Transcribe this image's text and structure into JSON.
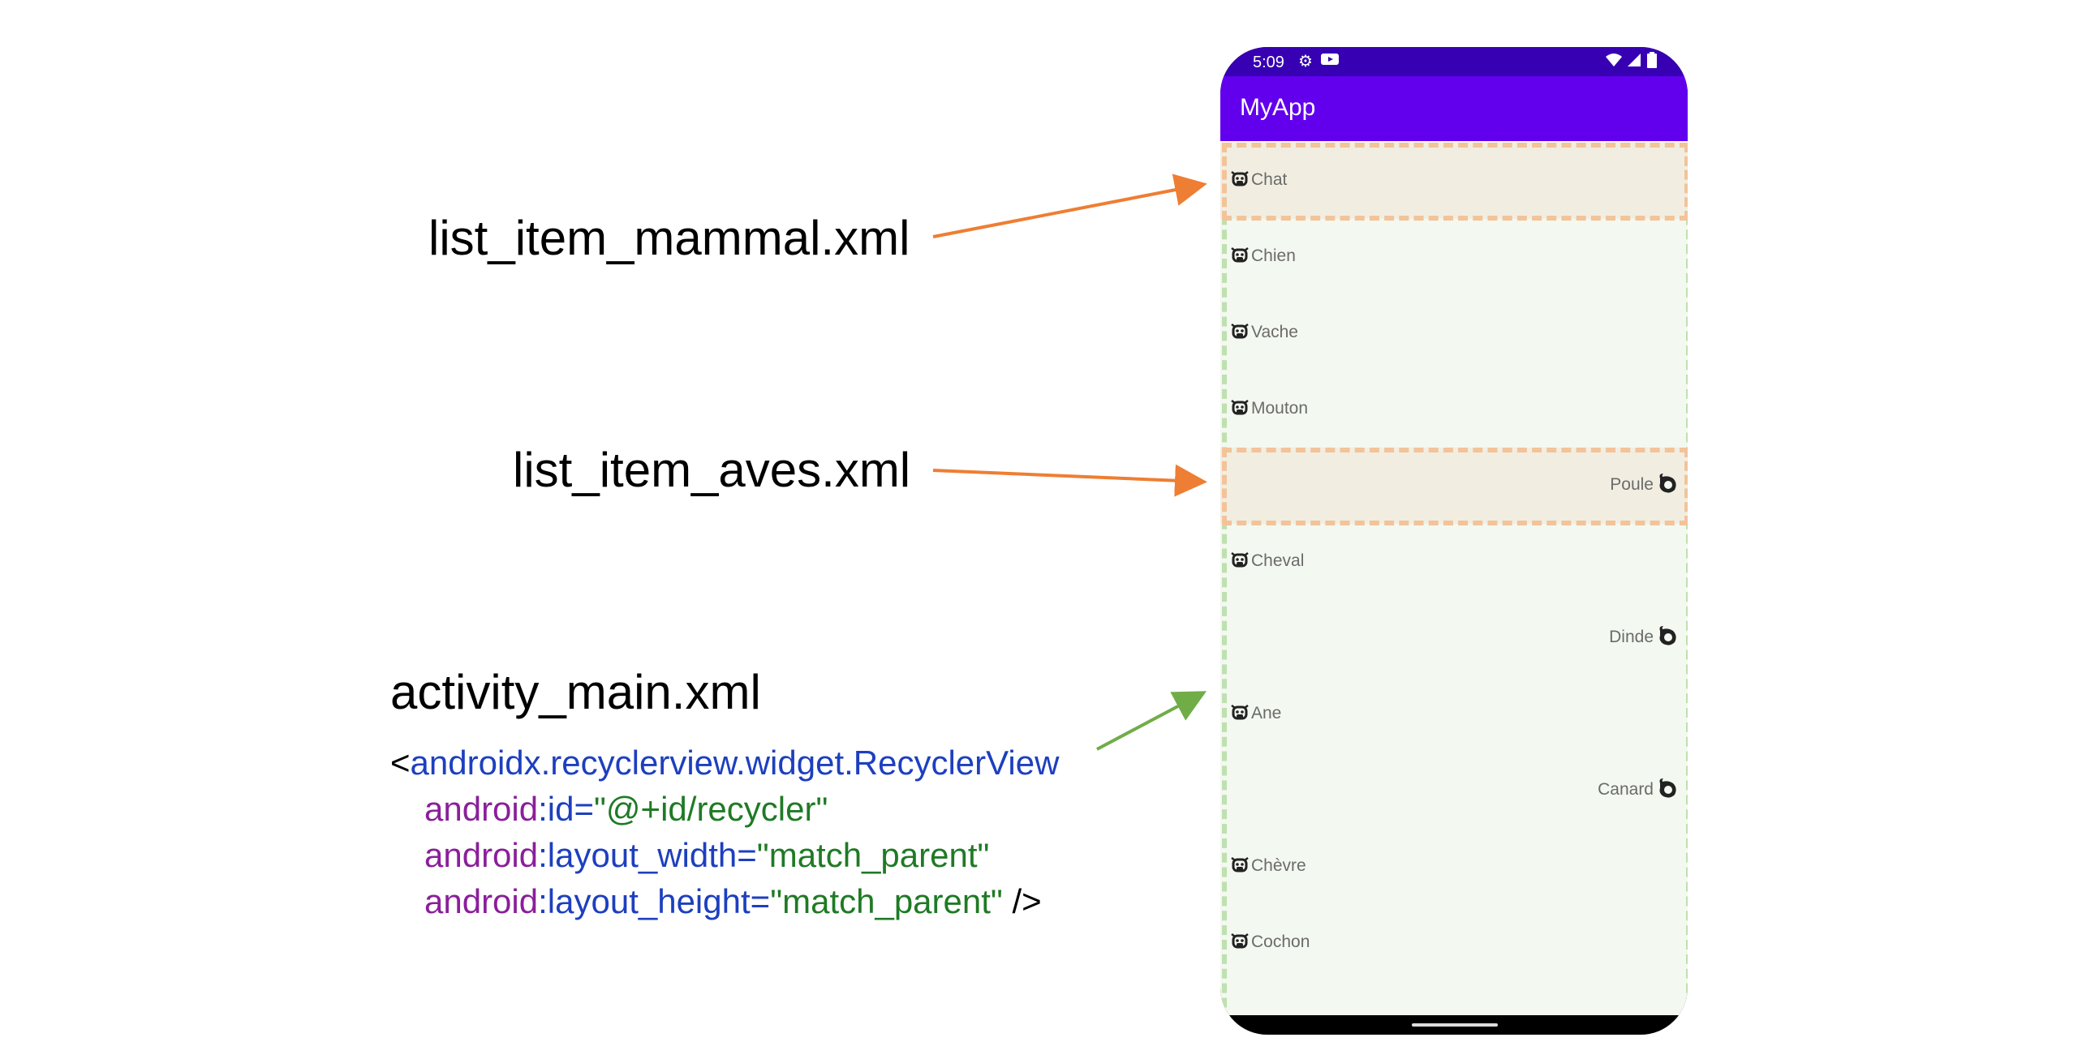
{
  "annotations": {
    "mammal_file": "list_item_mammal.xml",
    "aves_file": "list_item_aves.xml",
    "main_file": "activity_main.xml",
    "arrow_colors": {
      "mammal": "#ee7e33",
      "aves": "#ee7e33",
      "main": "#70ad47"
    }
  },
  "code": {
    "open": "<",
    "tag": "androidx.recyclerview.widget.RecyclerView",
    "lines": [
      {
        "ns": "android",
        "colon": ":",
        "attr": "id",
        "eq": "=",
        "value": "\"@+id/recycler\"",
        "end": ""
      },
      {
        "ns": "android",
        "colon": ":",
        "attr": "layout_width",
        "eq": "=",
        "value": "\"match_parent\"",
        "end": ""
      },
      {
        "ns": "android",
        "colon": ":",
        "attr": "layout_height",
        "eq": "=",
        "value": "\"match_parent\"",
        "end": " />"
      }
    ]
  },
  "phone": {
    "status": {
      "time": "5:09",
      "icons": [
        "gear-icon",
        "youtube-icon",
        "wifi-icon",
        "signal-icon",
        "battery-icon"
      ]
    },
    "app_title": "MyApp",
    "theme": {
      "status_bar": "#3700b3",
      "app_bar": "#6200ee"
    },
    "items": [
      {
        "kind": "mammal",
        "label": "Chat",
        "highlight": true
      },
      {
        "kind": "mammal",
        "label": "Chien",
        "highlight": false
      },
      {
        "kind": "mammal",
        "label": "Vache",
        "highlight": false
      },
      {
        "kind": "mammal",
        "label": "Mouton",
        "highlight": false
      },
      {
        "kind": "aves",
        "label": "Poule",
        "highlight": true
      },
      {
        "kind": "mammal",
        "label": "Cheval",
        "highlight": false
      },
      {
        "kind": "aves",
        "label": "Dinde",
        "highlight": false
      },
      {
        "kind": "mammal",
        "label": "Ane",
        "highlight": false
      },
      {
        "kind": "aves",
        "label": "Canard",
        "highlight": false
      },
      {
        "kind": "mammal",
        "label": "Chèvre",
        "highlight": false
      },
      {
        "kind": "mammal",
        "label": "Cochon",
        "highlight": false
      }
    ]
  }
}
